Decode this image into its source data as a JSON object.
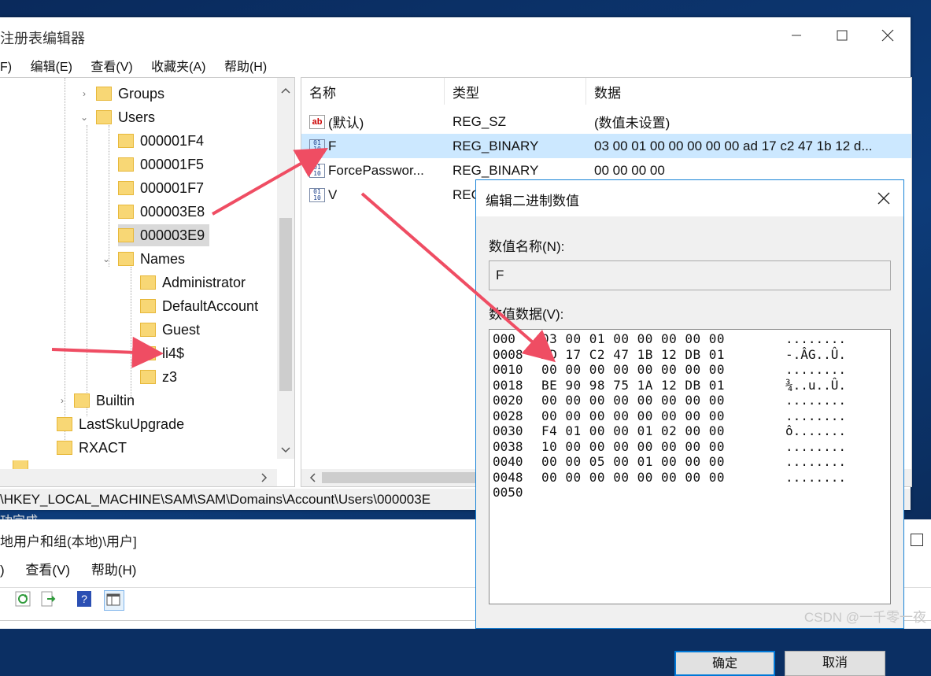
{
  "registry_window": {
    "title": "注册表编辑器",
    "title_visible": "注册表编辑器",
    "menu": [
      "文件(F)",
      "编辑(E)",
      "查看(V)",
      "收藏夹(A)",
      "帮助(H)"
    ],
    "menu_visible": [
      "F)",
      "编辑(E)",
      "查看(V)",
      "收藏夹(A)",
      "帮助(H)"
    ],
    "tree": [
      {
        "label": "Groups",
        "expander": "›",
        "level": 1
      },
      {
        "label": "Users",
        "expander": "⌄",
        "level": 1
      },
      {
        "label": "000001F4",
        "expander": "",
        "level": 2
      },
      {
        "label": "000001F5",
        "expander": "",
        "level": 2
      },
      {
        "label": "000001F7",
        "expander": "",
        "level": 2
      },
      {
        "label": "000003E8",
        "expander": "",
        "level": 2
      },
      {
        "label": "000003E9",
        "expander": "",
        "level": 2,
        "selected": true
      },
      {
        "label": "Names",
        "expander": "⌄",
        "level": 2
      },
      {
        "label": "Administrator",
        "expander": "",
        "level": 3
      },
      {
        "label": "DefaultAccount",
        "expander": "",
        "level": 3
      },
      {
        "label": "Guest",
        "expander": "",
        "level": 3
      },
      {
        "label": "li4$",
        "expander": "",
        "level": 3
      },
      {
        "label": "z3",
        "expander": "",
        "level": 3
      },
      {
        "label": "Builtin",
        "expander": "›",
        "level": 0
      },
      {
        "label": "LastSkuUpgrade",
        "expander": "",
        "level": -1
      },
      {
        "label": "RXACT",
        "expander": "",
        "level": -1
      }
    ],
    "columns": [
      "名称",
      "类型",
      "数据"
    ],
    "values": [
      {
        "name": "(默认)",
        "type": "REG_SZ",
        "data": "(数值未设置)",
        "icon": "string-value-icon"
      },
      {
        "name": "F",
        "type": "REG_BINARY",
        "data": "03 00 01 00 00 00 00 00 ad 17 c2 47 1b 12 d...",
        "icon": "binary-value-icon",
        "selected": true
      },
      {
        "name": "ForcePasswor...",
        "type": "REG_BINARY",
        "data": "00 00 00 00",
        "icon": "binary-value-icon"
      },
      {
        "name": "V",
        "type": "REC",
        "data": "",
        "icon": "binary-value-icon"
      }
    ],
    "status_path": "\\HKEY_LOCAL_MACHINE\\SAM\\SAM\\Domains\\Account\\Users\\000003E"
  },
  "dialog": {
    "title": "编辑二进制数值",
    "name_label": "数值名称(N):",
    "name_value": "F",
    "data_label": "数值数据(V):",
    "rows": [
      {
        "offset": "000",
        "bytes": "03 00 01 00 00 00 00 00",
        "ascii": "........"
      },
      {
        "offset": "0008",
        "bytes": "AD 17 C2 47 1B 12 DB 01",
        "ascii": "-.ÂG..Û."
      },
      {
        "offset": "0010",
        "bytes": "00 00 00 00 00 00 00 00",
        "ascii": "........"
      },
      {
        "offset": "0018",
        "bytes": "BE 90 98 75 1A 12 DB 01",
        "ascii": "¾..u..Û."
      },
      {
        "offset": "0020",
        "bytes": "00 00 00 00 00 00 00 00",
        "ascii": "........"
      },
      {
        "offset": "0028",
        "bytes": "00 00 00 00 00 00 00 00",
        "ascii": "........"
      },
      {
        "offset": "0030",
        "bytes": "F4 01 00 00 01 02 00 00",
        "ascii": "ô......."
      },
      {
        "offset": "0038",
        "bytes": "10 00 00 00 00 00 00 00",
        "ascii": "........"
      },
      {
        "offset": "0040",
        "bytes": "00 00 05 00 01 00 00 00",
        "ascii": "........"
      },
      {
        "offset": "0048",
        "bytes": "00 00 00 00 00 00 00 00",
        "ascii": "........"
      },
      {
        "offset": "0050",
        "bytes": "",
        "ascii": ""
      }
    ],
    "ok_label": "确定",
    "cancel_label": "取消"
  },
  "users_window": {
    "title": "地用户和组(本地)\\用户]",
    "menu": [
      ")",
      "查看(V)",
      "帮助(H)"
    ]
  },
  "background_text": "功完成。",
  "watermark": "CSDN @一千零一夜",
  "colors": {
    "arrow": "#ef4d63",
    "selection": "#cce8ff",
    "tree_selection": "#d9d9d9",
    "folder": "#f8d775",
    "dialog_border": "#1883d7"
  }
}
